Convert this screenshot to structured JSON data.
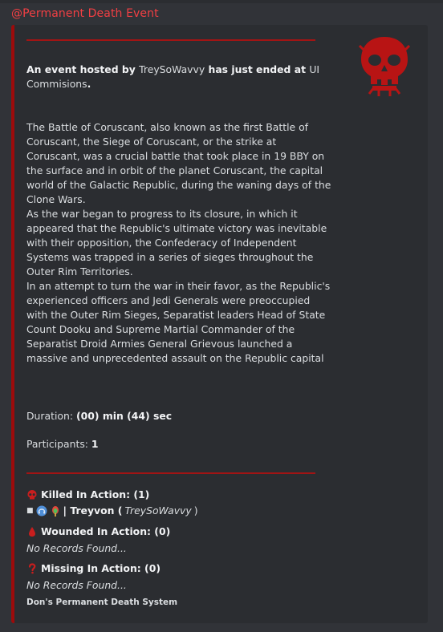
{
  "mention": "@Permanent Death Event",
  "embed": {
    "accent_color": "#9c0b0b",
    "thumbnail_icon": "red-skull-icon",
    "host": {
      "prefix": "An event hosted by ",
      "host_name": "TreySoWavvy",
      "middle": " has just ended at ",
      "place": "UI Commisions",
      "suffix": "."
    },
    "paragraphs": [
      "The Battle of Coruscant, also known as the first Battle of Coruscant, the Siege of Coruscant, or the strike at Coruscant, was a crucial battle that took place in 19 BBY on the surface and in orbit of the planet Coruscant, the capital world of the Galactic Republic, during the waning days of the Clone Wars.",
      "As the war began to progress to its closure, in which it appeared that the Republic's ultimate victory was inevitable with their opposition, the Confederacy of Independent Systems was trapped in a series of sieges throughout the Outer Rim Territories.",
      "In an attempt to turn the war in their favor, as the Republic's experienced officers and Jedi Generals were preoccupied with the Outer Rim Sieges, Separatist leaders Head of State Count Dooku and Supreme Martial Commander of the Separatist Droid Armies General Grievous launched a massive and unprecedented assault on the Republic capital"
    ],
    "duration_label": "Duration: ",
    "duration_value": "(00) min (44) sec",
    "participants_label": "Participants: ",
    "participants_value": "1",
    "fields": {
      "killed": {
        "name": "Killed In Action: (1)",
        "icon": "skull-icon",
        "entry_marker": "■",
        "entry_name": " | Treyvon (",
        "entry_user": "TreySoWavvy",
        "entry_close": ")"
      },
      "wounded": {
        "name": "Wounded In Action: (0)",
        "icon": "blood-drop-icon",
        "value": "No Records Found..."
      },
      "missing": {
        "name": "Missing In Action: (0)",
        "icon": "question-mark-icon",
        "value": "No Records Found..."
      }
    },
    "footer": "Don's Permanent Death System"
  }
}
